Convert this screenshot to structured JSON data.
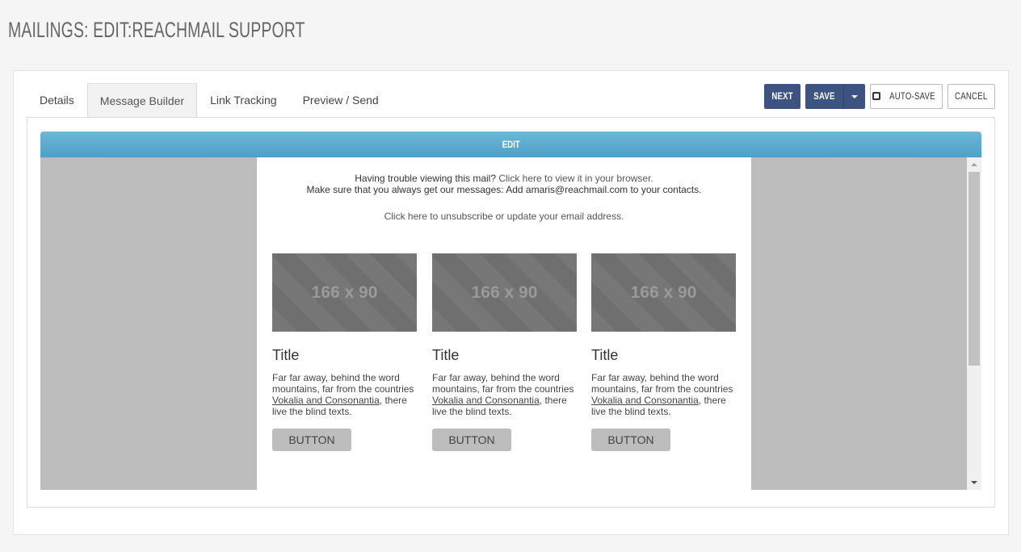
{
  "page": {
    "title": "MAILINGS: EDIT:REACHMAIL SUPPORT"
  },
  "tabs": [
    {
      "label": "Details"
    },
    {
      "label": "Message Builder",
      "active": true
    },
    {
      "label": "Link Tracking"
    },
    {
      "label": "Preview / Send"
    }
  ],
  "toolbar": {
    "next_label": "NEXT",
    "save_label": "SAVE",
    "autosave_label": "AUTO-SAVE",
    "cancel_label": "CANCEL"
  },
  "editor": {
    "bar_label": "EDIT",
    "preheader_line1_prefix": "Having trouble viewing this mail?",
    "preheader_line1_link": "Click here to view it in your browser.",
    "preheader_line2": "Make sure that you always get our messages: Add amaris@reachmail.com to your contacts.",
    "unsubscribe": "Click here to unsubscribe or update your email address.",
    "columns": [
      {
        "placeholder": "166 x 90",
        "title": "Title",
        "body_before": "Far far away, behind the word mountains, far from the countries ",
        "body_link": "Vokalia and Consonantia",
        "body_after": ", there live the blind texts.",
        "button": "BUTTON"
      },
      {
        "placeholder": "166 x 90",
        "title": "Title",
        "body_before": "Far far away, behind the word mountains, far from the countries ",
        "body_link": "Vokalia and Consonantia",
        "body_after": ", there live the blind texts.",
        "button": "BUTTON"
      },
      {
        "placeholder": "166 x 90",
        "title": "Title",
        "body_before": "Far far away, behind the word mountains, far from the countries ",
        "body_link": "Vokalia and Consonantia",
        "body_after": ", there live the blind texts.",
        "button": "BUTTON"
      }
    ]
  },
  "colors": {
    "primary_button": "#3d5382",
    "edit_bar": "#5aaed0",
    "canvas_gray": "#bdbdbd"
  }
}
